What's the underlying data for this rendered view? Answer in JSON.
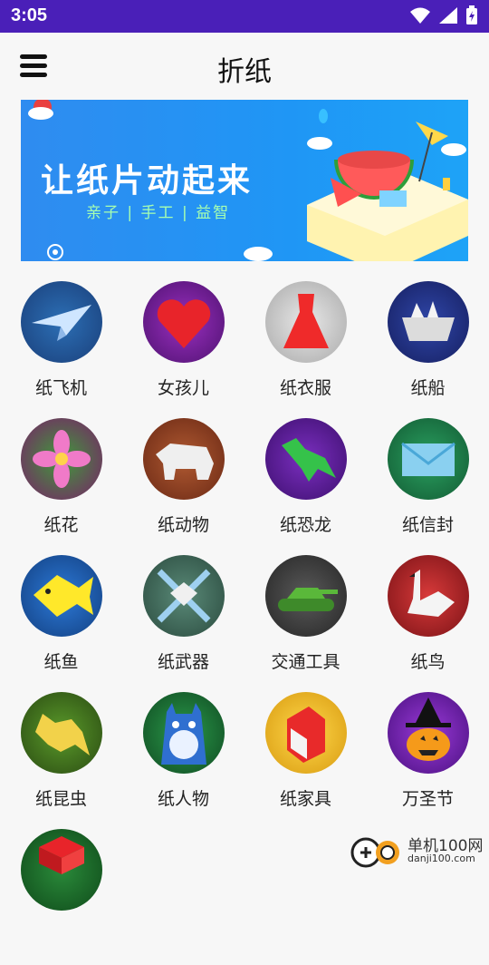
{
  "status_bar": {
    "time": "3:05",
    "bg": "#4a1fb8"
  },
  "app_bar": {
    "title": "折纸",
    "menu_icon": "hamburger-menu-icon"
  },
  "banner": {
    "title": "让纸片动起来",
    "subtitle": "亲子 | 手工 | 益智"
  },
  "categories": [
    {
      "label": "纸飞机",
      "icon": "paper-plane-icon",
      "bg": "#1e4f8f"
    },
    {
      "label": "女孩儿",
      "icon": "heart-icon",
      "bg": "#6a1a8a"
    },
    {
      "label": "纸衣服",
      "icon": "dress-icon",
      "bg": "#b9b9b9"
    },
    {
      "label": "纸船",
      "icon": "boat-icon",
      "bg": "#22307a"
    },
    {
      "label": "纸花",
      "icon": "flower-icon",
      "bg": "#2f7f2f"
    },
    {
      "label": "纸动物",
      "icon": "bear-icon",
      "bg": "#8a3b22"
    },
    {
      "label": "纸恐龙",
      "icon": "dinosaur-icon",
      "bg": "#5b1f8c"
    },
    {
      "label": "纸信封",
      "icon": "envelope-icon",
      "bg": "#1f7a4a"
    },
    {
      "label": "纸鱼",
      "icon": "fish-icon",
      "bg": "#1a55a8"
    },
    {
      "label": "纸武器",
      "icon": "crossed-swords-icon",
      "bg": "#3f6a5a"
    },
    {
      "label": "交通工具",
      "icon": "tank-icon",
      "bg": "#3a3a3a"
    },
    {
      "label": "纸鸟",
      "icon": "swan-icon",
      "bg": "#b5242a"
    },
    {
      "label": "纸昆虫",
      "icon": "frog-insect-icon",
      "bg": "#3e6f1d"
    },
    {
      "label": "纸人物",
      "icon": "totoro-icon",
      "bg": "#1d6e3a"
    },
    {
      "label": "纸家具",
      "icon": "box-icon",
      "bg": "#e8b21a"
    },
    {
      "label": "万圣节",
      "icon": "pumpkin-witch-icon",
      "bg": "#6a1e9a"
    },
    {
      "label": "",
      "icon": "pattern-icon",
      "bg": "#1f6b2a"
    }
  ],
  "watermark": {
    "line1": "单机100网",
    "line2": "danji100.com"
  }
}
